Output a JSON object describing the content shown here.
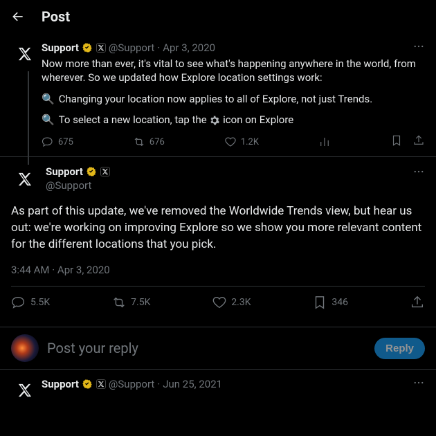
{
  "header": {
    "title": "Post"
  },
  "parent": {
    "user": "Support",
    "handle": "@Support",
    "sep": " · ",
    "date": "Apr 3, 2020",
    "text": "Now more than ever, it's vital to see what's happening anywhere in the world, from wherever. So we updated how Explore location settings work:",
    "bullet1": "Changing your location now applies to all of Explore, not just Trends.",
    "bullet2a": "To select a new location, tap the ",
    "bullet2b": " icon on Explore",
    "replies": "675",
    "reposts": "676",
    "likes": "1.2K"
  },
  "main": {
    "user": "Support",
    "handle": "@Support",
    "text": "As part of this update, we've removed the Worldwide Trends view, but hear us out: we're working on improving Explore so we show you more relevant content for the different locations that you pick.",
    "time": "3:44 AM",
    "sep": " · ",
    "date": "Apr 3, 2020",
    "replies": "5.5K",
    "reposts": "7.5K",
    "likes": "2.3K",
    "bookmarks": "346"
  },
  "reply": {
    "placeholder": "Post your reply",
    "button": "Reply"
  },
  "next": {
    "user": "Support",
    "handle": "@Support",
    "sep": " · ",
    "date": "Jun 25, 2021"
  }
}
